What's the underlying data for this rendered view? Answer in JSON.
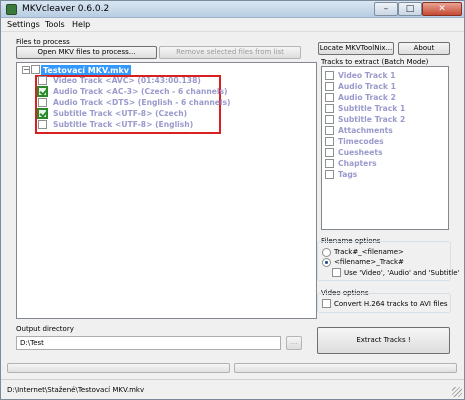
{
  "window": {
    "title": "MKVcleaver 0.6.0.2",
    "min_glyph": "–",
    "max_glyph": "□",
    "close_glyph": "✕"
  },
  "menu": [
    {
      "label": "Settings"
    },
    {
      "label": "Tools"
    },
    {
      "label": "Help"
    }
  ],
  "files": {
    "group_label": "Files to process",
    "open_button": "Open MKV files to process...",
    "remove_button": "Remove selected files from list",
    "tree": {
      "expander": "−",
      "root": {
        "label": "Testovací MKV.mkv",
        "checked": false
      },
      "tracks": [
        {
          "label": "Video Track <AVC> (01:43:00.138)",
          "checked": false
        },
        {
          "label": "Audio Track <AC-3> (Czech - 6 channels)",
          "checked": true
        },
        {
          "label": "Audio Track <DTS> (English - 6 channels)",
          "checked": false
        },
        {
          "label": "Subtitle Track <UTF-8> (Czech)",
          "checked": true
        },
        {
          "label": "Subtitle Track <UTF-8> (English)",
          "checked": false
        }
      ]
    }
  },
  "right": {
    "locate_button": "Locate MKVToolNix...",
    "about_button": "About",
    "batch_label": "Tracks to extract (Batch Mode)",
    "batch_items": [
      {
        "label": "Video Track 1"
      },
      {
        "label": "Audio Track 1"
      },
      {
        "label": "Audio Track 2"
      },
      {
        "label": "Subtitle Track 1"
      },
      {
        "label": "Subtitle Track 2"
      },
      {
        "label": "Attachments"
      },
      {
        "label": "Timecodes"
      },
      {
        "label": "Cuesheets"
      },
      {
        "label": "Chapters"
      },
      {
        "label": "Tags"
      }
    ],
    "filename_label": "Filename options",
    "filename_options": [
      {
        "label": "Track#_<filename>",
        "selected": false
      },
      {
        "label": "<filename>_Track#",
        "selected": true
      }
    ],
    "use_names_label": "Use 'Video', 'Audio' and 'Subtitle'",
    "video_label": "Video options",
    "convert_label": "Convert H.264 tracks to AVI files",
    "extract_button": "Extract Tracks !"
  },
  "output": {
    "label": "Output directory",
    "value": "D:\\Test",
    "browse_button": "..."
  },
  "status": {
    "text": "D:\\Internet\\Stažené\\Testovací MKV.mkv"
  }
}
